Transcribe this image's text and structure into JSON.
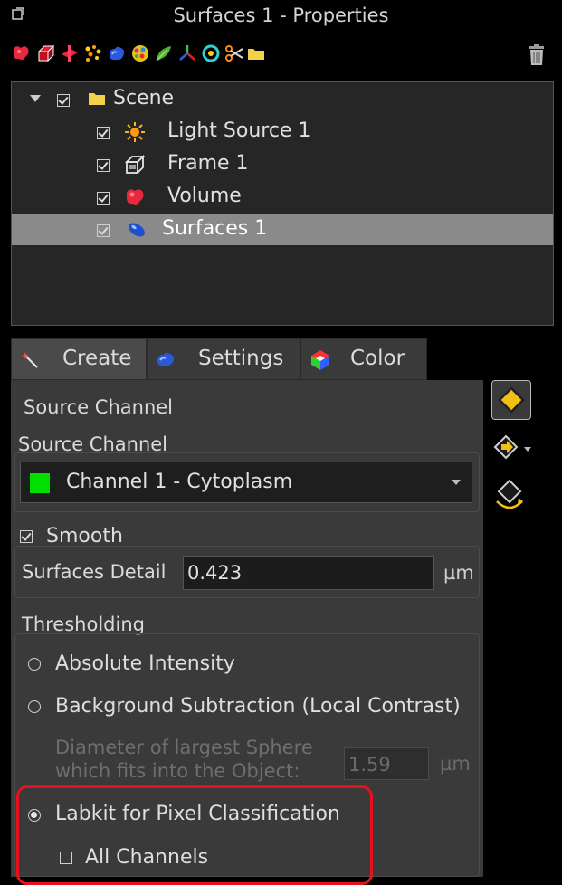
{
  "window": {
    "title": "Surfaces 1 - Properties"
  },
  "toolbar": {
    "icons": [
      "volume-icon",
      "frame-icon",
      "clipping-plane-icon",
      "spots-icon",
      "surfaces-icon",
      "cells-icon",
      "filaments-icon",
      "reference-frame-icon",
      "measurement-points-icon",
      "scissors-icon",
      "group-folder-icon"
    ],
    "delete_icon": "trash-icon"
  },
  "tree": {
    "items": [
      {
        "label": "Scene",
        "icon": "folder-icon",
        "checked": true,
        "expanded": true
      },
      {
        "label": "Light Source 1",
        "icon": "light-source-icon",
        "checked": true
      },
      {
        "label": "Frame 1",
        "icon": "frame-icon",
        "checked": true
      },
      {
        "label": "Volume",
        "icon": "volume-icon",
        "checked": true
      },
      {
        "label": "Surfaces 1",
        "icon": "surfaces-icon",
        "checked": true,
        "selected": true
      }
    ]
  },
  "tabs": [
    {
      "label": "Create",
      "icon": "wand-icon",
      "active": true
    },
    {
      "label": "Settings",
      "icon": "settings-icon",
      "active": false
    },
    {
      "label": "Color",
      "icon": "color-icon",
      "active": false
    }
  ],
  "create": {
    "source_channel_section": "Source Channel",
    "source_channel_label": "Source Channel",
    "channel_value": "Channel 1 - Cytoplasm",
    "channel_color": "#00e000",
    "smooth": {
      "label": "Smooth",
      "checked": true
    },
    "surfaces_detail": {
      "label": "Surfaces Detail",
      "value": "0.423",
      "unit": "µm"
    },
    "thresholding": {
      "title": "Thresholding",
      "options": [
        {
          "label": "Absolute Intensity",
          "selected": false
        },
        {
          "label": "Background Subtraction (Local Contrast)",
          "selected": false
        },
        {
          "label": "Labkit for Pixel Classification",
          "selected": true
        }
      ],
      "sphere_label": "Diameter of largest Sphere which fits into the Object:",
      "sphere_value": "1.59",
      "sphere_unit": "µm",
      "all_channels": {
        "label": "All Channels",
        "checked": false
      }
    }
  },
  "colors": {
    "highlight": "#e8101a",
    "selected_row": "#8a8a8a"
  }
}
